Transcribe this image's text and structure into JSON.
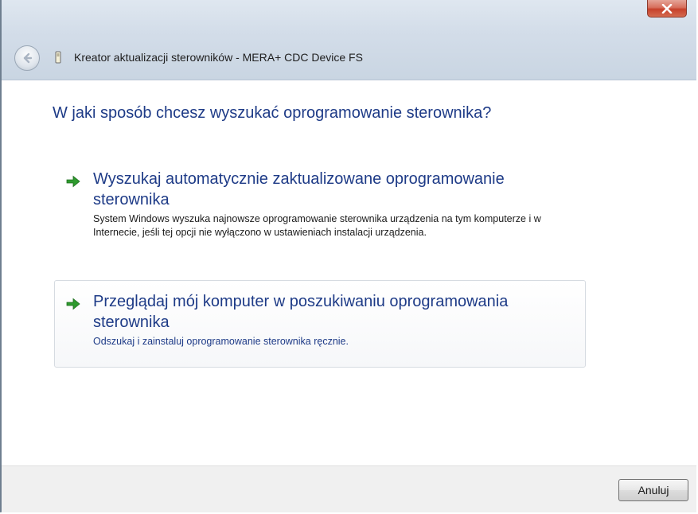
{
  "window": {
    "title": "Kreator aktualizacji sterowników - MERA+ CDC Device FS",
    "close_label": "x"
  },
  "main": {
    "heading": "W jaki sposób chcesz wyszukać oprogramowanie sterownika?",
    "options": [
      {
        "title": "Wyszukaj automatycznie zaktualizowane oprogramowanie sterownika",
        "description": "System Windows wyszuka najnowsze oprogramowanie sterownika urządzenia na tym komputerze i w Internecie, jeśli tej opcji nie wyłączono w ustawieniach instalacji urządzenia.",
        "icon": "green-arrow-icon"
      },
      {
        "title": "Przeglądaj mój komputer w poszukiwaniu oprogramowania sterownika",
        "description": "Odszukaj i zainstaluj oprogramowanie sterownika ręcznie.",
        "icon": "green-arrow-icon"
      }
    ]
  },
  "footer": {
    "cancel_label": "Anuluj"
  },
  "colors": {
    "heading": "#1e3b87",
    "arrow": "#2e9a2e",
    "close": "#c7412b"
  }
}
